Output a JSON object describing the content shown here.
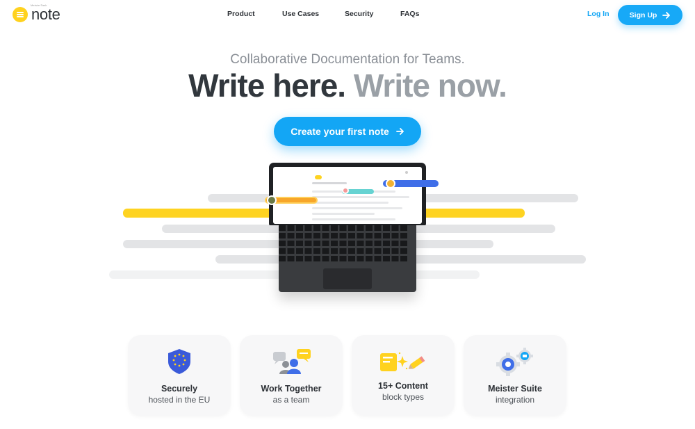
{
  "header": {
    "logo_super": "MeisterTask",
    "logo_text": "note",
    "nav": [
      "Product",
      "Use Cases",
      "Security",
      "FAQs"
    ],
    "login_label": "Log In",
    "signup_label": "Sign Up",
    "signup_icon": "arrow-right-icon"
  },
  "hero": {
    "subtitle": "Collaborative Documentation for Teams.",
    "headline_dark": "Write here.",
    "headline_light": "Write now.",
    "cta_label": "Create your first note",
    "cta_icon": "arrow-right-icon"
  },
  "features": [
    {
      "title": "Securely",
      "subtitle": "hosted in the EU",
      "icon": "eu-shield-icon"
    },
    {
      "title": "Work Together",
      "subtitle": "as a team",
      "icon": "team-chat-icon"
    },
    {
      "title": "15+ Content",
      "subtitle": "block types",
      "icon": "content-blocks-icon"
    },
    {
      "title": "Meister Suite",
      "subtitle": "integration",
      "icon": "gears-icon"
    }
  ],
  "colors": {
    "brand_yellow": "#ffd21f",
    "accent_blue": "#13a6f5",
    "text_dark": "#31373d",
    "text_light": "#9aa0a6"
  }
}
